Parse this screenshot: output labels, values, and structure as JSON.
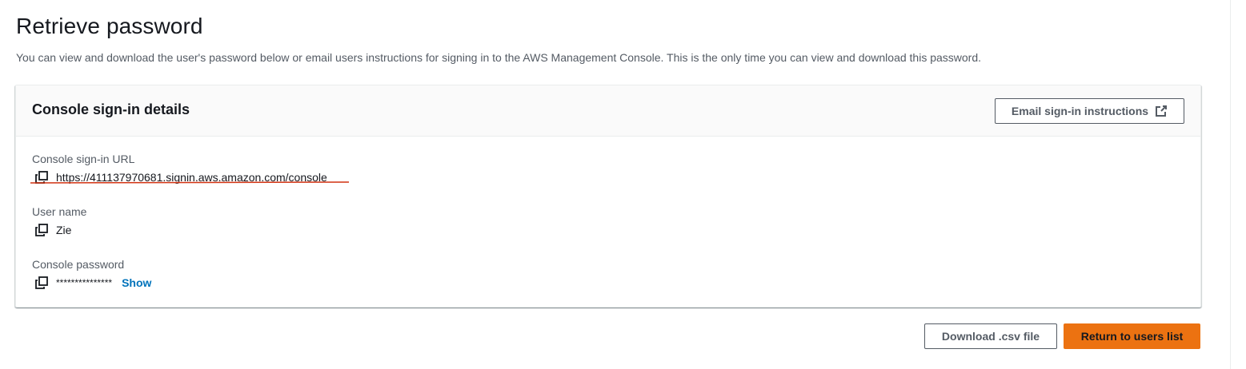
{
  "page": {
    "title": "Retrieve password",
    "description": "You can view and download the user's password below or email users instructions for signing in to the AWS Management Console. This is the only time you can view and download this password."
  },
  "panel": {
    "title": "Console sign-in details",
    "email_button_label": "Email sign-in instructions",
    "fields": {
      "url_label": "Console sign-in URL",
      "url_value": "https://411137970681.signin.aws.amazon.com/console",
      "username_label": "User name",
      "username_value": "Zie",
      "password_label": "Console password",
      "password_value": "***************",
      "show_label": "Show"
    }
  },
  "footer": {
    "download_label": "Download .csv file",
    "return_label": "Return to users list"
  },
  "icons": {
    "copy": "copy-icon",
    "external_link": "external-link-icon"
  },
  "colors": {
    "primary_button": "#ec7211",
    "link": "#0073bb",
    "annotation": "#d13212"
  }
}
